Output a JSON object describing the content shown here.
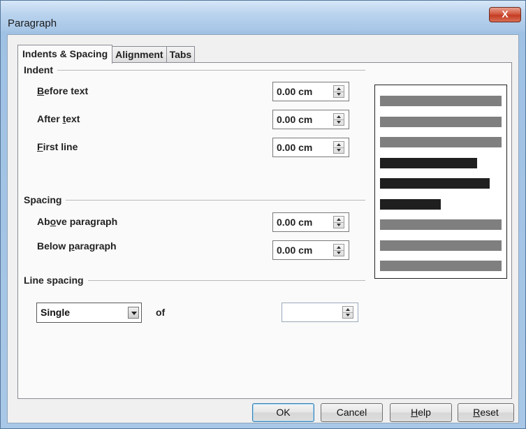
{
  "window": {
    "title": "Paragraph",
    "close_label": "X"
  },
  "tabs": [
    {
      "label": "Indents & Spacing",
      "active": true
    },
    {
      "label": "Alignment",
      "active": false
    },
    {
      "label": "Tabs",
      "active": false
    }
  ],
  "indent": {
    "heading": "Indent",
    "before_text": {
      "label_pre": "",
      "label_mnemonic": "B",
      "label_post": "efore text",
      "value": "0.00 cm"
    },
    "after_text": {
      "label_pre": "After ",
      "label_mnemonic": "t",
      "label_post": "ext",
      "value": "0.00 cm"
    },
    "first_line": {
      "label_pre": "",
      "label_mnemonic": "F",
      "label_post": "irst line",
      "value": "0.00 cm"
    }
  },
  "spacing": {
    "heading": "Spacing",
    "above": {
      "label_pre": "Ab",
      "label_mnemonic": "o",
      "label_post": "ve paragraph",
      "value": "0.00 cm"
    },
    "below": {
      "label_pre": "Below ",
      "label_mnemonic": "p",
      "label_post": "aragraph",
      "value": "0.00 cm"
    }
  },
  "line_spacing": {
    "heading": "Line spacing",
    "selected": "Single",
    "of_label": "of",
    "of_value": ""
  },
  "preview": {
    "lines": [
      {
        "shade": "light",
        "fraction": 1.0
      },
      {
        "shade": "light",
        "fraction": 1.0
      },
      {
        "shade": "light",
        "fraction": 1.0
      },
      {
        "shade": "dark",
        "fraction": 0.8
      },
      {
        "shade": "dark",
        "fraction": 0.9
      },
      {
        "shade": "dark",
        "fraction": 0.5
      },
      {
        "shade": "light",
        "fraction": 1.0
      },
      {
        "shade": "light",
        "fraction": 1.0
      },
      {
        "shade": "light",
        "fraction": 1.0
      }
    ]
  },
  "buttons": {
    "ok": "OK",
    "cancel": "Cancel",
    "help_mnemonic": "H",
    "help_rest": "elp",
    "reset_mnemonic": "R",
    "reset_rest": "eset"
  }
}
